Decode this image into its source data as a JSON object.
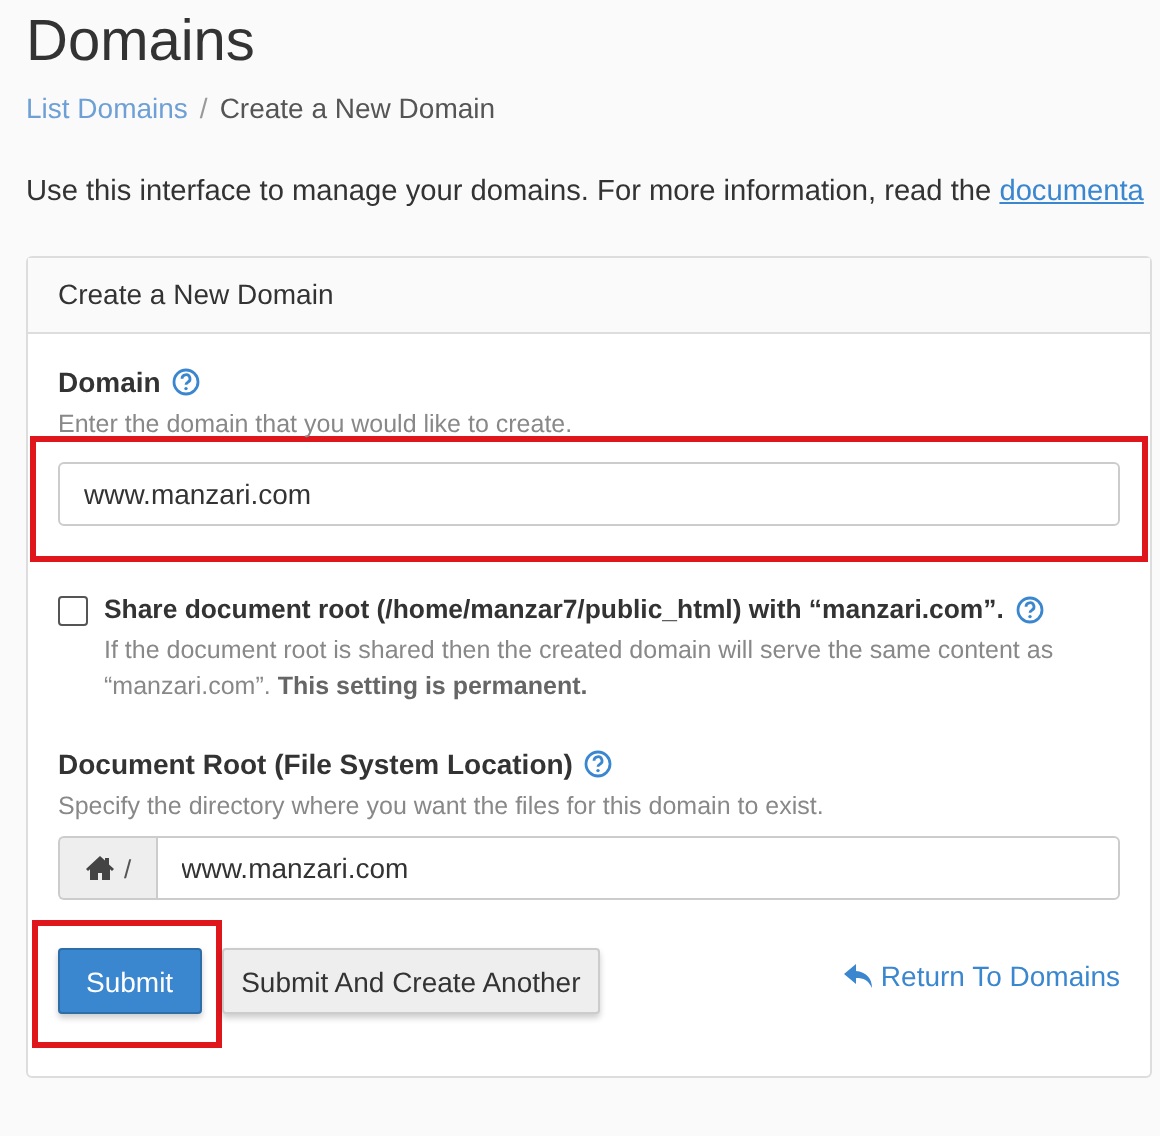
{
  "page": {
    "title": "Domains"
  },
  "breadcrumb": {
    "separator": "/",
    "items": [
      {
        "label": "List Domains",
        "kind": "link"
      },
      {
        "label": "Create a New Domain",
        "kind": "current"
      }
    ]
  },
  "intro": {
    "text": "Use this interface to manage your domains. For more information, read the",
    "link": "documenta"
  },
  "panel": {
    "title": "Create a New Domain",
    "domain": {
      "label": "Domain",
      "hint": "Enter the domain that you would like to create.",
      "value": "www.manzari.com",
      "highlighted": true
    },
    "share_root": {
      "label": "Share document root (/home/manzar7/public_html) with “manzari.com”.",
      "checked": false,
      "help": "If the document root is shared then the created domain will serve the same content as “manzari.com”. **This setting is permanent.**"
    },
    "document_root": {
      "label": "Document Root (File System Location)",
      "hint": "Specify the directory where you want the files for this domain to exist.",
      "prefix": "/",
      "value": "www.manzari.com"
    },
    "buttons": [
      {
        "label": "Submit",
        "kind": "primary",
        "highlighted": true
      },
      {
        "label": "Submit And Create Another",
        "kind": "default",
        "highlighted": false
      }
    ],
    "return_link": "Return To Domains"
  }
}
